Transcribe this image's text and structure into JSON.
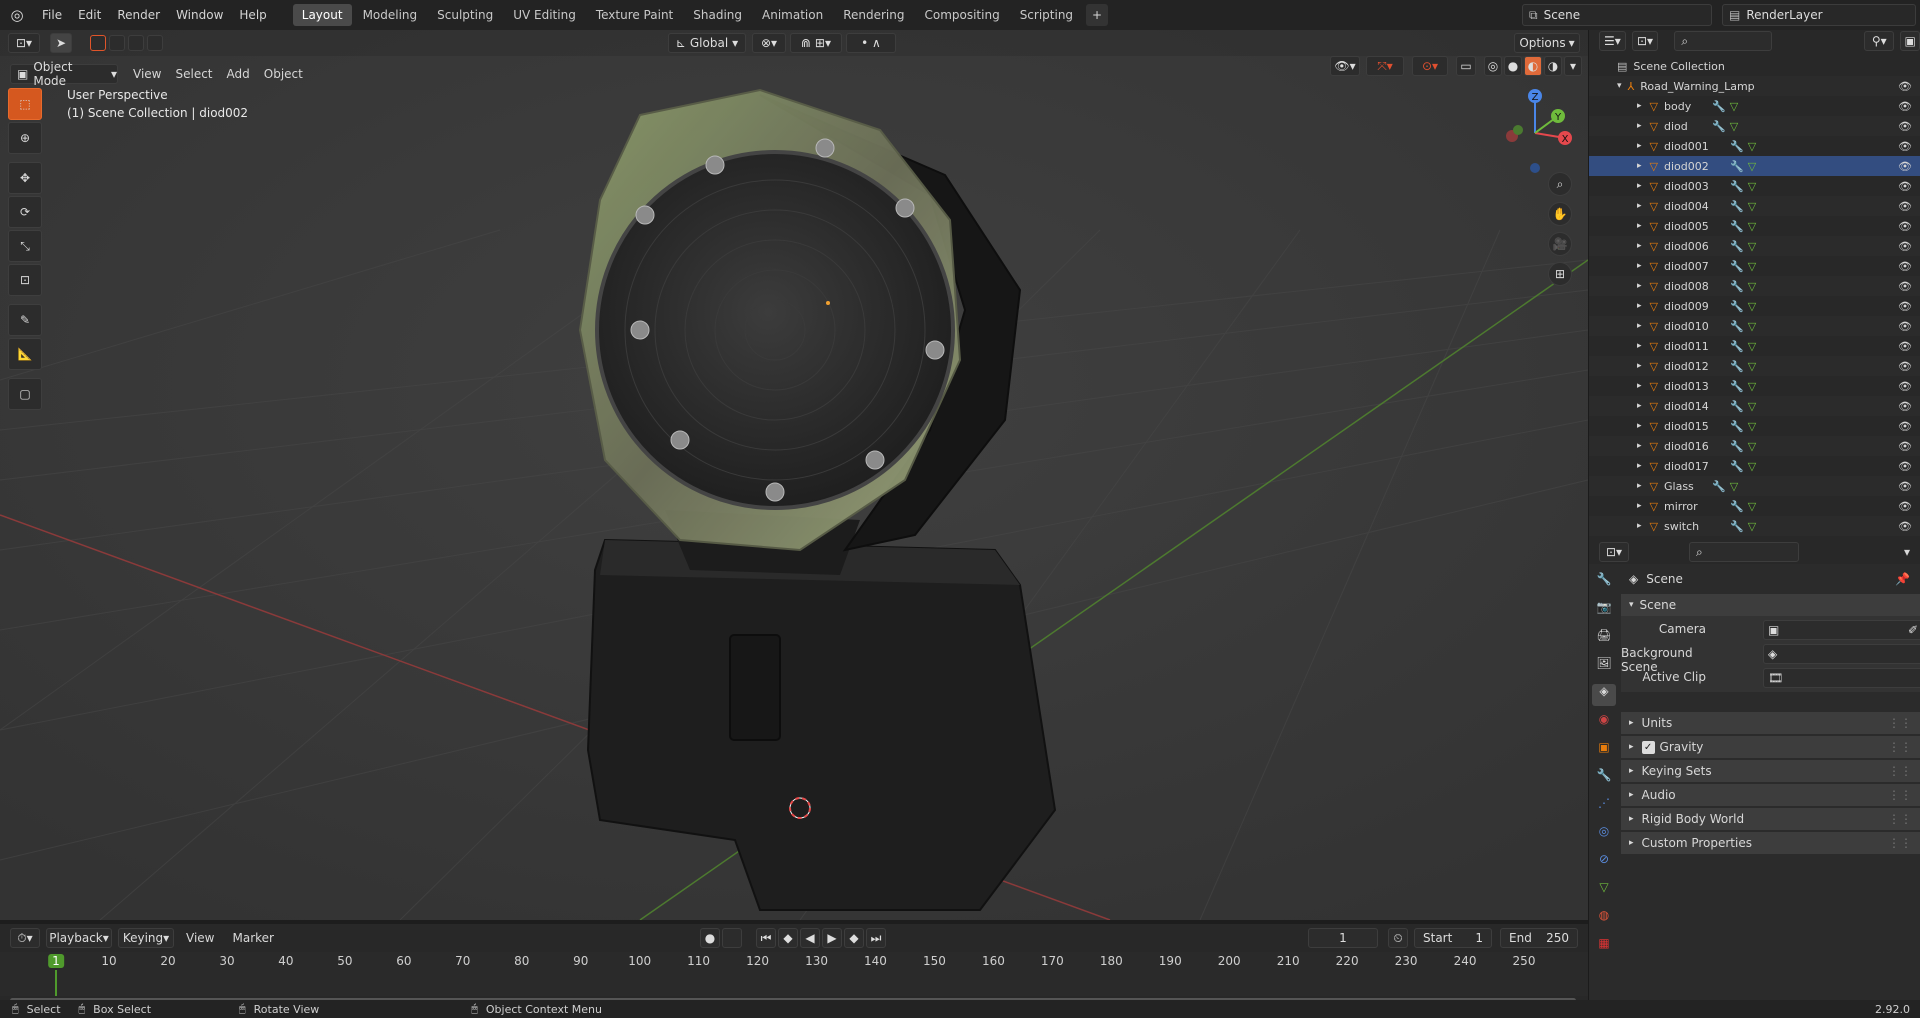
{
  "topbar": {
    "menu": [
      "File",
      "Edit",
      "Render",
      "Window",
      "Help"
    ],
    "workspaces": [
      "Layout",
      "Modeling",
      "Sculpting",
      "UV Editing",
      "Texture Paint",
      "Shading",
      "Animation",
      "Rendering",
      "Compositing",
      "Scripting"
    ],
    "active_workspace": "Layout",
    "scene_name": "Scene",
    "view_layer": "RenderLayer"
  },
  "viewport": {
    "mode": "Object Mode",
    "menu": [
      "View",
      "Select",
      "Add",
      "Object"
    ],
    "orientation": "Global",
    "options_label": "Options",
    "overlay_title": "User Perspective",
    "overlay_subtitle": "(1) Scene Collection | diod002",
    "gizmo": {
      "x": "X",
      "y": "Y",
      "z": "Z"
    }
  },
  "outliner": {
    "root": "Scene Collection",
    "collection": "Road_Warning_Lamp",
    "items": [
      "body",
      "diod",
      "diod001",
      "diod002",
      "diod003",
      "diod004",
      "diod005",
      "diod006",
      "diod007",
      "diod008",
      "diod009",
      "diod010",
      "diod011",
      "diod012",
      "diod013",
      "diod014",
      "diod015",
      "diod016",
      "diod017",
      "Glass",
      "mirror",
      "switch"
    ],
    "selected": "diod002"
  },
  "properties": {
    "context": "Scene",
    "panel": "Scene",
    "camera_label": "Camera",
    "background_scene_label": "Background Scene",
    "active_clip_label": "Active Clip",
    "subpanels": [
      "Units",
      "Gravity",
      "Keying Sets",
      "Audio",
      "Rigid Body World",
      "Custom Properties"
    ],
    "gravity_checked": true
  },
  "timeline": {
    "menus": [
      "Playback",
      "Keying",
      "View",
      "Marker"
    ],
    "current_frame": "1",
    "start_label": "Start",
    "start": "1",
    "end_label": "End",
    "end": "250",
    "ticks": [
      "1",
      "10",
      "20",
      "30",
      "40",
      "50",
      "60",
      "70",
      "80",
      "90",
      "100",
      "110",
      "120",
      "130",
      "140",
      "150",
      "160",
      "170",
      "180",
      "190",
      "200",
      "210",
      "220",
      "230",
      "240",
      "250"
    ]
  },
  "statusbar": {
    "select": "Select",
    "box_select": "Box Select",
    "rotate_view": "Rotate View",
    "context_menu": "Object Context Menu",
    "version": "2.92.0"
  },
  "colors": {
    "accent": "#e87d0d",
    "active_tool": "#d5581f",
    "selection": "#334d80",
    "x_axis": "#e5484d",
    "y_axis": "#6fbb3c",
    "z_axis": "#4a86e8"
  }
}
